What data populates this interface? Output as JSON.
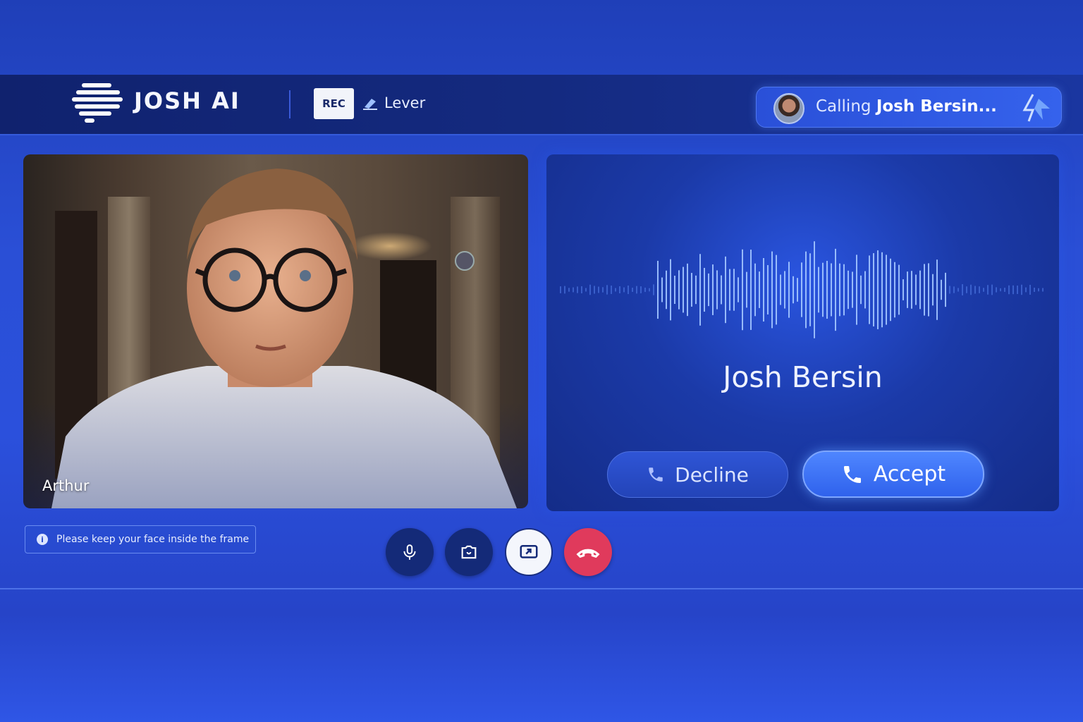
{
  "app": {
    "brand": "JOSH AI"
  },
  "topbar": {
    "rec_label": "REC",
    "integration_label": "Lever",
    "calling_prefix": "Calling",
    "calling_name": "Josh Bersin..."
  },
  "self_video": {
    "participant_name": "Arthur"
  },
  "incoming_call": {
    "caller_name": "Josh Bersin",
    "decline_label": "Decline",
    "accept_label": "Accept"
  },
  "hint": {
    "text": "Please keep your face inside the frame"
  },
  "controls": [
    {
      "icon": "microphone-icon"
    },
    {
      "icon": "camera-switch-icon"
    },
    {
      "icon": "share-screen-icon"
    },
    {
      "icon": "hang-up-icon"
    }
  ],
  "colors": {
    "accent": "#2f62ec",
    "hangup": "#e03a5c",
    "topbar": "#10226e"
  }
}
